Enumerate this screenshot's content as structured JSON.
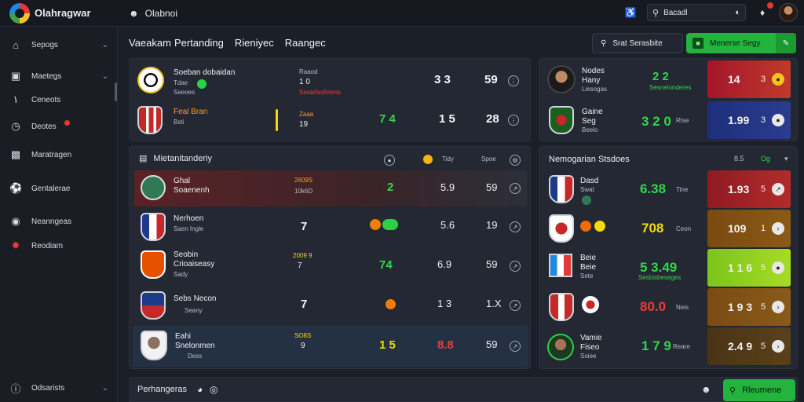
{
  "app": {
    "name": "Olahragwar"
  },
  "top": {
    "user": "Olabnoi",
    "search_value": "Bacadl"
  },
  "sidebar": {
    "items": [
      {
        "label": "Sepogs",
        "icon": "home-icon",
        "chev": true
      },
      {
        "label": "Maetegs",
        "icon": "monitor-icon",
        "chev": true
      },
      {
        "label": "Ceneots",
        "icon": "figure-icon",
        "chev": false
      },
      {
        "label": "Deotes",
        "icon": "clock-icon",
        "chev": false
      },
      {
        "label": "Maratragen",
        "icon": "chart-icon",
        "chev": false
      },
      {
        "label": "Gentalerae",
        "icon": "soccer-icon",
        "chev": false
      },
      {
        "label": "Neanngeas",
        "icon": "globe-icon",
        "chev": false
      },
      {
        "label": "Reodiam",
        "icon": "target-icon",
        "chev": false
      }
    ],
    "footer": "Odsarists"
  },
  "tabs": [
    "Vaeakam",
    "Pertanding",
    "Rieniyec",
    "Raangec"
  ],
  "buttons": {
    "dark": "Srat Serasbite",
    "green": "Menerse Segy"
  },
  "top_matches": [
    {
      "name": "Soeban dobaidan",
      "sub": "Tdae",
      "sub2": "Seeoes",
      "mid1": "Raaod",
      "mid2": "1 0",
      "mid3": "Seatefasfeiens",
      "score": "3 3",
      "val": "59"
    },
    {
      "name": "Feal Bran",
      "sub": "Bsti",
      "sub2": "",
      "mid1": "Zaaa",
      "mid2": "19",
      "mid3": "",
      "score": "7 4",
      "num": "1 5",
      "val": "28"
    }
  ],
  "main_table": {
    "title": "Mietanitanderiy",
    "h1": "Tidy",
    "h2": "Spoe",
    "rows": [
      {
        "name": "Ghal",
        "name2": "Soaenenh",
        "mid1": "2609S",
        "mid2": "10k6D",
        "n1": "2",
        "n2": "5.9",
        "val": "59"
      },
      {
        "name": "Nerhoen",
        "name2": "Saen Ingle",
        "mid1": "",
        "mid2": "",
        "n1": "7",
        "n2": "5.6",
        "val": "19"
      },
      {
        "name": "Seobin",
        "name2": "Crioaiseasy",
        "sub": "Sady",
        "mid1": "2009 9",
        "mid2": "7",
        "n1": "74",
        "n2": "6.9",
        "val": "59"
      },
      {
        "name": "Sebs Necon",
        "name2": "Seany",
        "mid1": "",
        "mid2": "",
        "n1": "7",
        "n2": "1 3",
        "val": "1.X"
      },
      {
        "name": "Eahi",
        "name2": "Snelonmen",
        "sub": "Dess",
        "mid1": "SO8S",
        "mid2": "9",
        "n1": "1 5",
        "n2": "8.8",
        "val": "59"
      }
    ]
  },
  "right_top": [
    {
      "name": "Nodes",
      "sub": "Hany",
      "sub2": "Liesogas",
      "val": "2 2",
      "lbl": "Sesnelonderes",
      "v": "14",
      "n": "3"
    },
    {
      "name": "Gaine",
      "sub": "Seg",
      "sub2": "Beelo",
      "val": "3 2 0",
      "lbl": "Rtse",
      "v": "1.99",
      "n": "3"
    }
  ],
  "right_table": {
    "title": "Nemogarian Stsdoes",
    "h1": "8.5",
    "h2": "Og",
    "rows": [
      {
        "name": "Dasd",
        "sub": "Swat",
        "val": "6.38",
        "lbl": "Tine",
        "v": "1.93",
        "n": "5"
      },
      {
        "name": "",
        "sub": "",
        "val": "708",
        "lbl": "Ceon",
        "v": "109",
        "n": "1"
      },
      {
        "name": "Beie",
        "sub": "Beie",
        "sub2": "Sete",
        "val": "5 3.49",
        "lbl": "Sesbisbeseges",
        "v": "1 1 6",
        "n": "5"
      },
      {
        "name": "",
        "sub": "",
        "val": "80.0",
        "lbl": "Neis",
        "v": "1 9 3",
        "n": "5"
      },
      {
        "name": "Vamie",
        "sub": "Fiseo",
        "sub2": "Soiee",
        "val": "1 7 9",
        "lbl": "Reare",
        "v": "2.4 9",
        "n": "5"
      }
    ]
  },
  "bottom": {
    "left": "Perhangeras",
    "button": "Rleumene"
  },
  "colors": {
    "accent": "#22b43c",
    "panel": "#232833",
    "bg": "#1b1f27"
  }
}
